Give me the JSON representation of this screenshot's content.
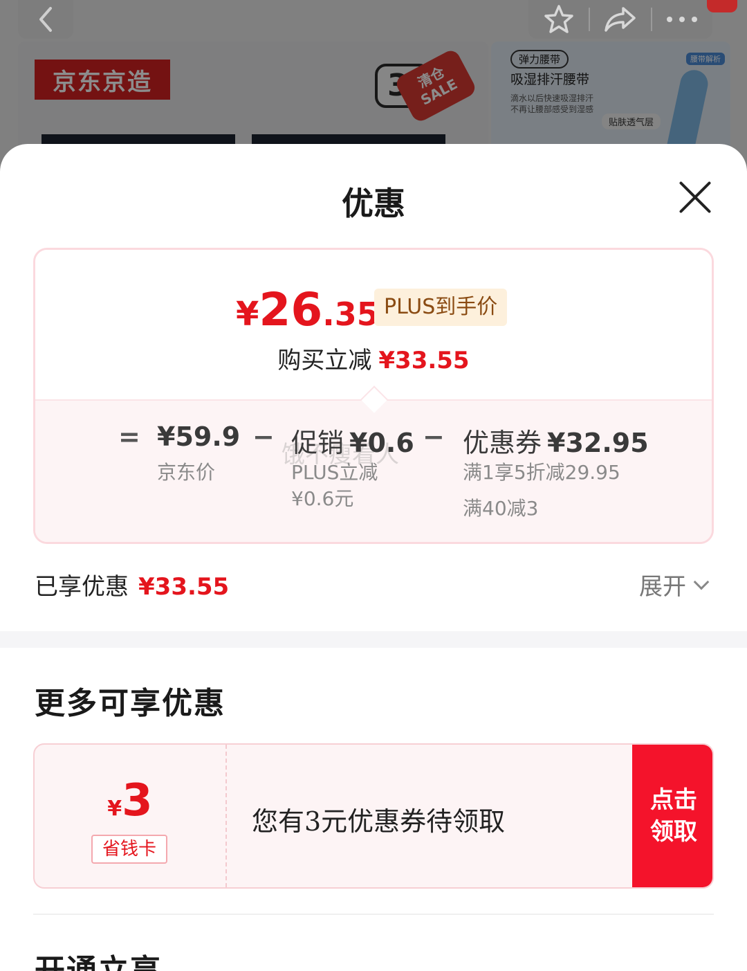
{
  "background": {
    "brand_logo": "京东京造",
    "sale_tag": "清仓 SALE",
    "sale_number": "3",
    "side_card": {
      "tag": "弹力腰带",
      "title": "吸湿排汗腰带",
      "desc_line1": "滴水以后快速吸湿排汗",
      "desc_line2": "不再让腰部感受到湿感",
      "layer_label": "贴肤透气层",
      "badge": "腰带解析"
    }
  },
  "sheet": {
    "title": "优惠",
    "price": {
      "currency": "¥",
      "integer": "26",
      "decimal": ".35",
      "badge": "PLUS到手价",
      "save_label": "购买立减",
      "save_amount": "¥33.55"
    },
    "breakdown": {
      "equals": "=",
      "minus": "−",
      "jd_price": {
        "value": "¥59.9",
        "label": "京东价"
      },
      "promo": {
        "label": "促销",
        "value": "¥0.6",
        "sub1": "PLUS立减",
        "sub2": "¥0.6元"
      },
      "coupon": {
        "label": "优惠券",
        "value": "¥32.95",
        "sub1": "满1享5折减29.95",
        "sub2": "满40减3"
      },
      "watermark": "饿不瘦着人"
    },
    "enjoyed": {
      "label": "已享优惠",
      "amount": "¥33.55"
    },
    "expand_label": "展开",
    "more_title": "更多可享优惠",
    "coupon_card": {
      "currency": "¥",
      "amount": "3",
      "tag": "省钱卡",
      "text": "您有3元优惠券待领取",
      "button_line1": "点击",
      "button_line2": "领取"
    },
    "next_section_title": "开通立享"
  },
  "colors": {
    "accent_red": "#e4151d",
    "button_red": "#f4132b",
    "plus_badge_bg": "#fdf0dc",
    "plus_badge_text": "#8a4b12"
  }
}
